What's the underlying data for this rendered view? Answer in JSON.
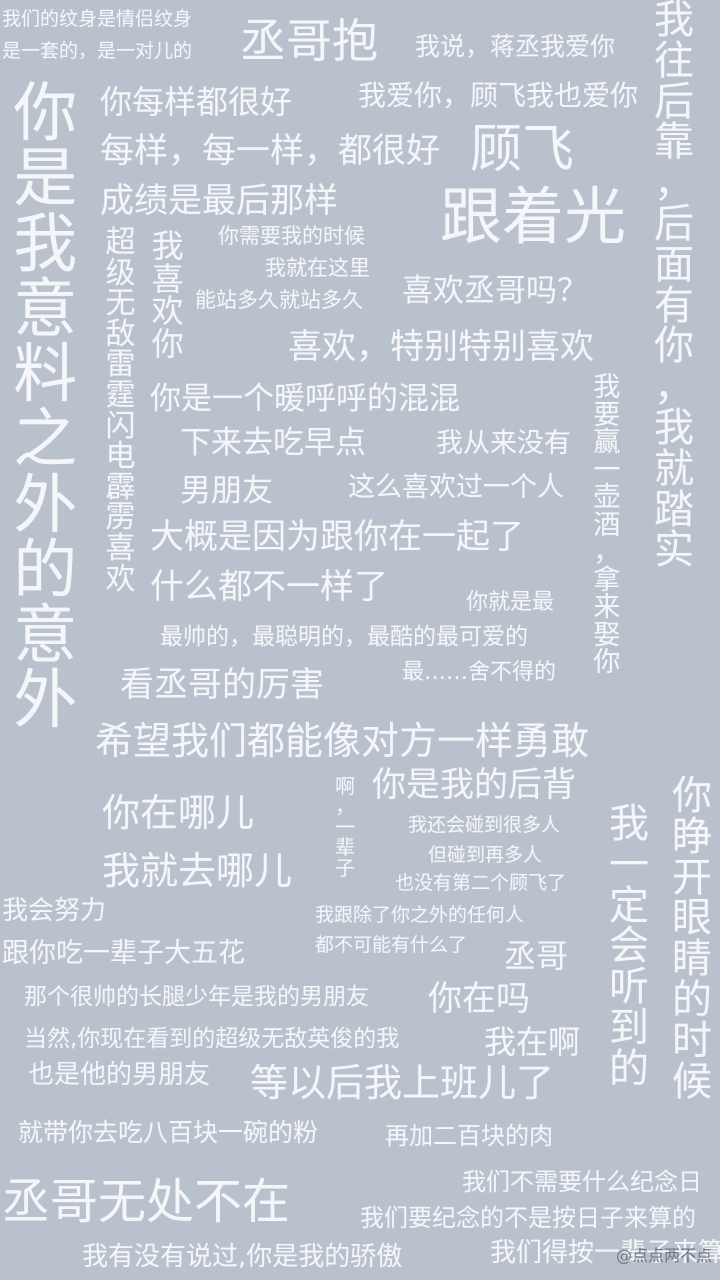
{
  "colors": {
    "background": "#b9c1cd",
    "text": "#f4f6f9"
  },
  "phrases": [
    "我们的纹身是情侣纹身",
    "是一套的，是一对儿的",
    "丞哥抱",
    "我说，蒋丞我爱你",
    "你每样都很好",
    "我爱你，顾飞我也爱你",
    "每样，每一样，都很好",
    "顾飞",
    "成绩是最后那样",
    "跟着光",
    "你需要我的时候",
    "我就在这里",
    "能站多久就站多久",
    "喜欢丞哥吗？",
    "喜欢，特别特别喜欢",
    "你是一个暖呼呼的混混",
    "下来去吃早点",
    "我从来没有",
    "男朋友",
    "这么喜欢过一个人",
    "大概是因为跟你在一起了",
    "什么都不一样了",
    "你就是最",
    "最帅的，最聪明的，最酷的最可爱的",
    "看丞哥的厉害",
    "最……舍不得的",
    "希望我们都能像对方一样勇敢",
    "你是我的后背",
    "你在哪儿",
    "我还会碰到很多人",
    "但碰到再多人",
    "我就去哪儿",
    "也没有第二个顾飞了",
    "我会努力",
    "我跟除了你之外的任何人",
    "都不可能有什么了",
    "跟你吃一辈子大五花",
    "丞哥",
    "那个很帅的长腿少年是我的男朋友",
    "你在吗",
    "当然,你现在看到的超级无敌英俊的我",
    "我在啊",
    "也是他的男朋友",
    "等以后我上班儿了",
    "就带你去吃八百块一碗的粉",
    "再加二百块的肉",
    "我们不需要什么纪念日",
    "丞哥无处不在",
    "我们要纪念的不是按日子来算的",
    "我有没有说过,你是我的骄傲",
    "我们得按一辈子来算"
  ],
  "vertical_phrases": [
    "你是我意料之外的意外",
    "超级无敌雷霆闪电霹雳喜欢",
    "我喜欢你",
    "我往后靠，后面有你，我就踏实",
    "我要赢一壶酒，拿来娶你",
    "啊，一辈子",
    "我一定会听到的",
    "你睁开眼睛的时候"
  ],
  "watermark": "@点点两不点"
}
